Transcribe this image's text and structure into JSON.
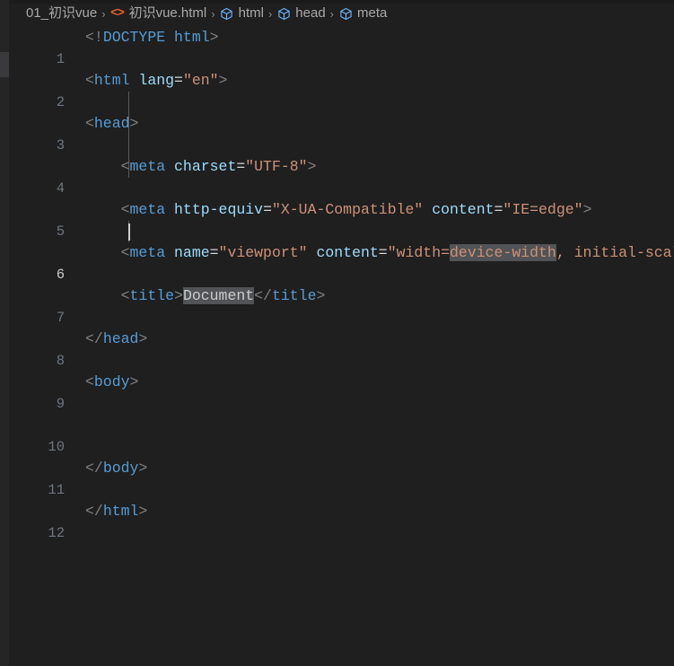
{
  "window": {
    "app": "vscode-editor",
    "background_color": "#1f1f1f"
  },
  "breadcrumb": {
    "separator": "›",
    "items": [
      {
        "label": "01_初识vue",
        "icon": "none"
      },
      {
        "label": "初识vue.html",
        "icon": "html-file-icon"
      },
      {
        "label": "html",
        "icon": "symbol-cube-icon"
      },
      {
        "label": "head",
        "icon": "symbol-cube-icon"
      },
      {
        "label": "meta",
        "icon": "symbol-cube-icon"
      }
    ]
  },
  "editor": {
    "language": "html",
    "active_line": 6,
    "cursor_line": 10,
    "lines": [
      {
        "n": "1",
        "text": "<!DOCTYPE html>"
      },
      {
        "n": "2",
        "text": "<html lang=\"en\">"
      },
      {
        "n": "3",
        "text": "<head>"
      },
      {
        "n": "4",
        "text": "    <meta charset=\"UTF-8\">"
      },
      {
        "n": "5",
        "text": "    <meta http-equiv=\"X-UA-Compatible\" content=\"IE=edge\">"
      },
      {
        "n": "6",
        "text": "    <meta name=\"viewport\" content=\"width=device-width, initial-scale"
      },
      {
        "n": "7",
        "text": "    <title>Document</title>"
      },
      {
        "n": "8",
        "text": "</head>"
      },
      {
        "n": "9",
        "text": "<body>"
      },
      {
        "n": "10",
        "text": ""
      },
      {
        "n": "11",
        "text": "</body>"
      },
      {
        "n": "12",
        "text": "</html>"
      }
    ],
    "highlighted_words": [
      "device-width",
      "Document"
    ]
  },
  "colors": {
    "tag": "#569cd6",
    "attribute": "#9cdcfe",
    "string": "#ce9178",
    "punctuation": "#808080",
    "text": "#cccccc",
    "line_number": "#6e7681",
    "line_number_active": "#cccccc",
    "highlight_background": "#515356",
    "editor_background": "#1f1f1f",
    "html_file_icon": "#e8622a",
    "symbol_icon": "#6cb6ff"
  }
}
